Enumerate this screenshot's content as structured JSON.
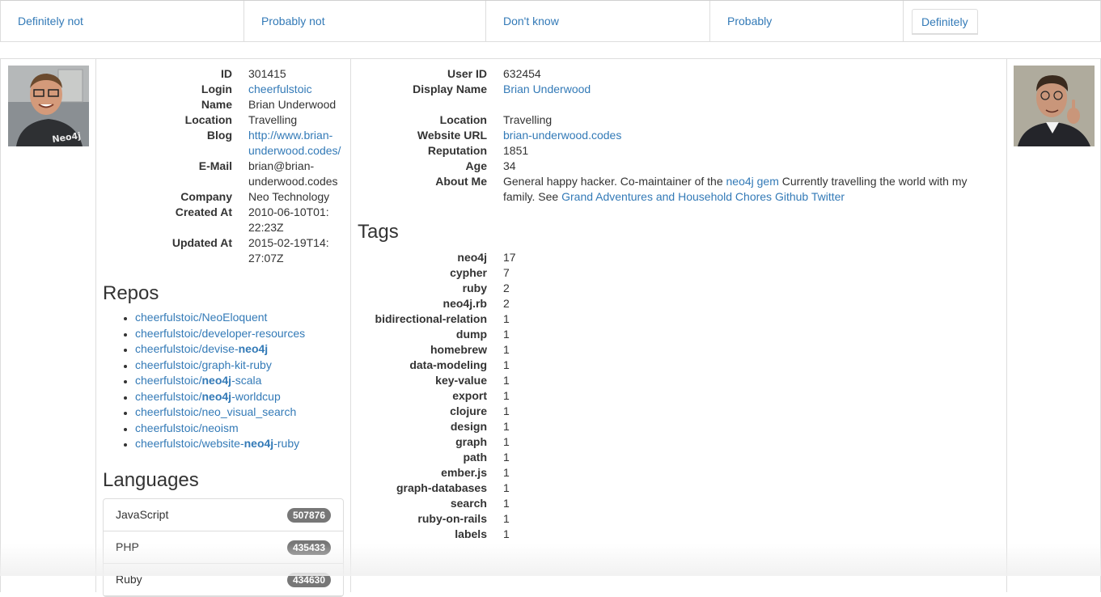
{
  "choices": [
    "Definitely not",
    "Probably not",
    "Don't know",
    "Probably",
    "Definitely"
  ],
  "github": {
    "fields": [
      {
        "label": "ID",
        "value": "301415",
        "link": false
      },
      {
        "label": "Login",
        "value": "cheerfulstoic",
        "link": true
      },
      {
        "label": "Name",
        "value": "Brian Underwood",
        "link": false
      },
      {
        "label": "Location",
        "value": "Travelling",
        "link": false
      },
      {
        "label": "Blog",
        "value": "http://www.brian-underwood.codes/",
        "link": true
      },
      {
        "label": "E-Mail",
        "value": "brian@brian-underwood.codes",
        "link": false
      },
      {
        "label": "Company",
        "value": "Neo Technology",
        "link": false
      },
      {
        "label": "Created At",
        "value": "2010-06-10T01:22:23Z",
        "link": false
      },
      {
        "label": "Updated At",
        "value": "2015-02-19T14:27:07Z",
        "link": false
      }
    ],
    "repos_heading": "Repos",
    "repos": [
      {
        "prefix": "cheerfulstoic/NeoEloquent",
        "bold": "",
        "suffix": ""
      },
      {
        "prefix": "cheerfulstoic/developer-resources",
        "bold": "",
        "suffix": ""
      },
      {
        "prefix": "cheerfulstoic/devise-",
        "bold": "neo4j",
        "suffix": ""
      },
      {
        "prefix": "cheerfulstoic/graph-kit-ruby",
        "bold": "",
        "suffix": ""
      },
      {
        "prefix": "cheerfulstoic/",
        "bold": "neo4j",
        "suffix": "-scala"
      },
      {
        "prefix": "cheerfulstoic/",
        "bold": "neo4j",
        "suffix": "-worldcup"
      },
      {
        "prefix": "cheerfulstoic/neo_visual_search",
        "bold": "",
        "suffix": ""
      },
      {
        "prefix": "cheerfulstoic/neoism",
        "bold": "",
        "suffix": ""
      },
      {
        "prefix": "cheerfulstoic/website-",
        "bold": "neo4j",
        "suffix": "-ruby"
      }
    ],
    "languages_heading": "Languages",
    "languages": [
      {
        "name": "JavaScript",
        "count": "507876"
      },
      {
        "name": "PHP",
        "count": "435433"
      },
      {
        "name": "Ruby",
        "count": "434630"
      }
    ]
  },
  "stackoverflow": {
    "user_id_label": "User ID",
    "user_id": "632454",
    "display_name_label": "Display Name",
    "display_name": "Brian Underwood",
    "location_label": "Location",
    "location": "Travelling",
    "website_label": "Website URL",
    "website": "brian-underwood.codes",
    "reputation_label": "Reputation",
    "reputation": "1851",
    "age_label": "Age",
    "age": "34",
    "about_label": "About Me",
    "about": {
      "t1": "General happy hacker. Co-maintainer of the ",
      "l1": "neo4j gem",
      "t2": " Currently travelling the world with my family. See ",
      "l2": "Grand Adventures and Household Chores",
      "t3": " ",
      "l3": "Github",
      "t4": " ",
      "l4": "Twitter"
    },
    "tags_heading": "Tags",
    "tags": [
      {
        "name": "neo4j",
        "count": "17"
      },
      {
        "name": "cypher",
        "count": "7"
      },
      {
        "name": "ruby",
        "count": "2"
      },
      {
        "name": "neo4j.rb",
        "count": "2"
      },
      {
        "name": "bidirectional-relation",
        "count": "1"
      },
      {
        "name": "dump",
        "count": "1"
      },
      {
        "name": "homebrew",
        "count": "1"
      },
      {
        "name": "data-modeling",
        "count": "1"
      },
      {
        "name": "key-value",
        "count": "1"
      },
      {
        "name": "export",
        "count": "1"
      },
      {
        "name": "clojure",
        "count": "1"
      },
      {
        "name": "design",
        "count": "1"
      },
      {
        "name": "graph",
        "count": "1"
      },
      {
        "name": "path",
        "count": "1"
      },
      {
        "name": "ember.js",
        "count": "1"
      },
      {
        "name": "graph-databases",
        "count": "1"
      },
      {
        "name": "search",
        "count": "1"
      },
      {
        "name": "ruby-on-rails",
        "count": "1"
      },
      {
        "name": "labels",
        "count": "1"
      }
    ]
  },
  "colors": {
    "link": "#337ab7",
    "badge": "#777777",
    "border": "#dddddd"
  }
}
